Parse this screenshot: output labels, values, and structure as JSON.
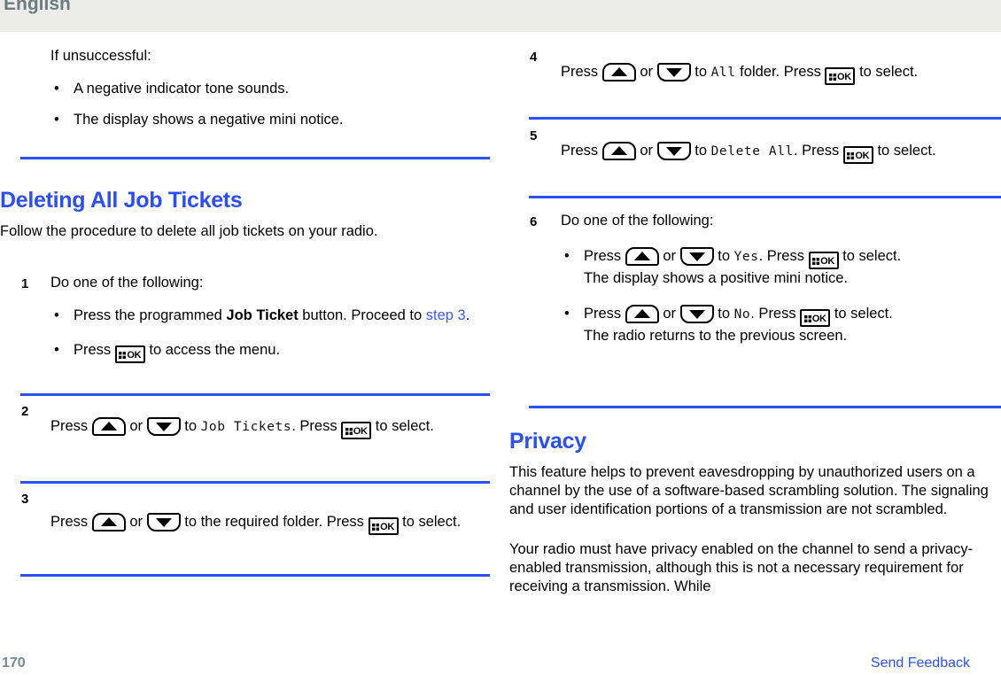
{
  "header": {
    "language_label": "English"
  },
  "footer": {
    "page_number": "170",
    "feedback_link": "Send Feedback"
  },
  "icons": {
    "ok_button": "ok-key-icon",
    "ok_label": "OK",
    "up_arrow": "up-arrow-key-icon",
    "down_arrow": "down-arrow-key-icon"
  },
  "left_column": {
    "intro": {
      "lead": "If unsuccessful:",
      "bullets": [
        "A negative indicator tone sounds.",
        "The display shows a negative mini notice."
      ]
    },
    "section": {
      "title": "Deleting All Job Tickets",
      "intro": "Follow the procedure to delete all job tickets on your radio."
    },
    "steps": [
      {
        "number": "1",
        "lead": "Do one of the following:",
        "bullets": [
          {
            "text_before": "Press the programmed ",
            "bold": "Job Ticket",
            "text_after": " button. Proceed to ",
            "link": "step 3",
            "text_end": "."
          },
          {
            "press": "Press",
            "after_ok": " to access the menu."
          }
        ]
      },
      {
        "number": "2",
        "press": "Press",
        "or": "or",
        "to": "to",
        "target": "Job Tickets",
        "press2": ". Press",
        "tail": "to select."
      },
      {
        "number": "3",
        "press": "Press",
        "or": "or",
        "to": "to the required folder. Press",
        "tail": "to select."
      }
    ]
  },
  "right_column": {
    "steps": [
      {
        "number": "4",
        "press": "Press",
        "or": "or",
        "to": "to",
        "target": "All",
        "after_target": " folder. Press",
        "tail": "to select."
      },
      {
        "number": "5",
        "press": "Press",
        "or": "or",
        "to": "to",
        "target": "Delete All",
        "after_target": ". Press",
        "tail": "to select."
      },
      {
        "number": "6",
        "lead": "Do one of the following:",
        "bullets": [
          {
            "press": "Press",
            "or": "or",
            "to": "to",
            "target": "Yes",
            "after_target": ". Press",
            "tail": "to select.",
            "note": "The display shows a positive mini notice."
          },
          {
            "press": "Press",
            "or": "or",
            "to": "to",
            "target": "No",
            "after_target": ". Press",
            "tail": "to select.",
            "note": "The radio returns to the previous screen."
          }
        ]
      }
    ],
    "section": {
      "title": "Privacy",
      "paragraphs": [
        "This feature helps to prevent eavesdropping by unauthorized users on a channel by the use of a software-based scrambling solution. The signaling and user identification portions of a transmission are not scrambled.",
        "Your radio must have privacy enabled on the channel to send a privacy-enabled transmission, although this is not a necessary requirement for receiving a transmission. While"
      ]
    }
  },
  "colors": {
    "heading_blue": "#2b4ef5",
    "rule_blue": "#2b52f7",
    "link_blue": "#3b5bf0",
    "header_band": "#ececea",
    "header_text": "#6d7b7e",
    "page_number": "#77888c"
  }
}
